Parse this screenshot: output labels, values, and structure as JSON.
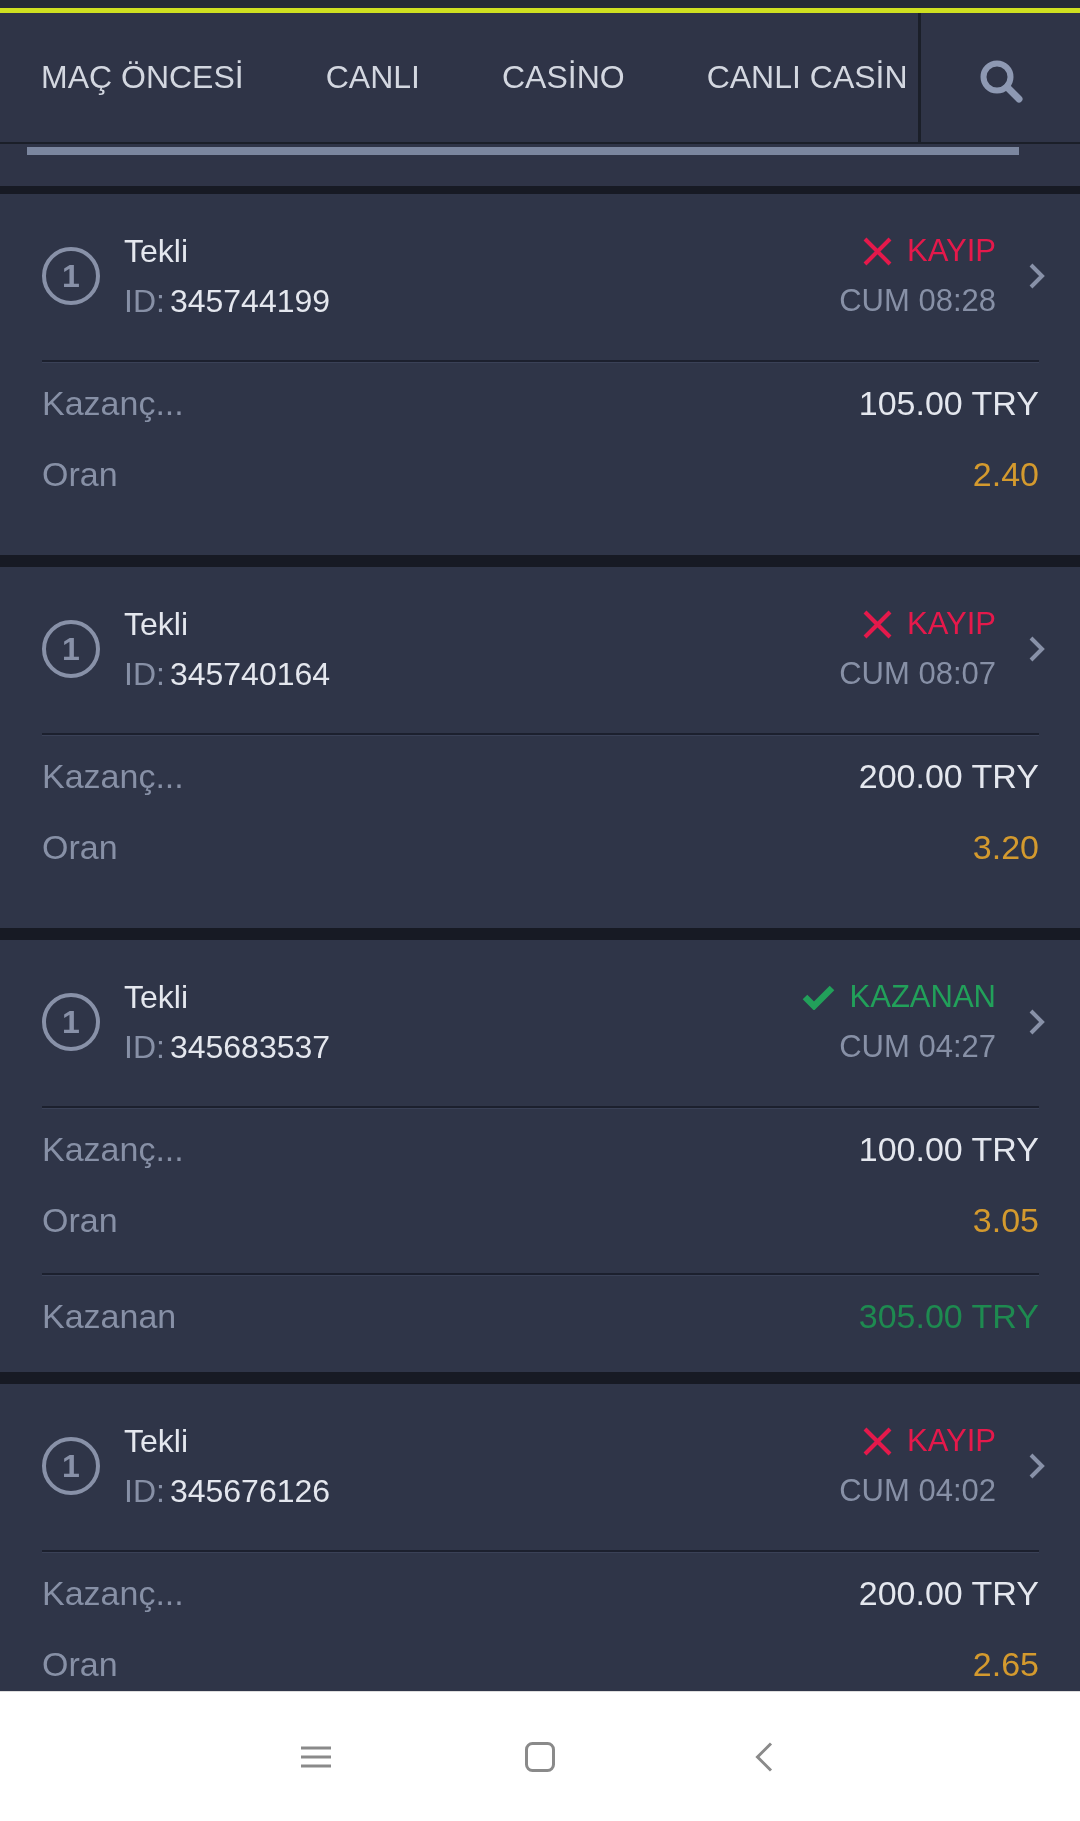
{
  "tabs": [
    {
      "label": "MAÇ ÖNCESİ"
    },
    {
      "label": "CANLI"
    },
    {
      "label": "CASİNO"
    },
    {
      "label": "CANLI CASİN"
    }
  ],
  "bets": [
    {
      "count": "1",
      "type": "Tekli",
      "id_label": "ID:",
      "id": "345744199",
      "won": false,
      "status_label": "KAYIP",
      "time": "CUM 08:28",
      "rows": [
        {
          "kind": "stake",
          "label": "Kazanç...",
          "value": "105.00 TRY"
        },
        {
          "kind": "odds",
          "label": "Oran",
          "value": "2.40"
        }
      ]
    },
    {
      "count": "1",
      "type": "Tekli",
      "id_label": "ID:",
      "id": "345740164",
      "won": false,
      "status_label": "KAYIP",
      "time": "CUM 08:07",
      "rows": [
        {
          "kind": "stake",
          "label": "Kazanç...",
          "value": "200.00 TRY"
        },
        {
          "kind": "odds",
          "label": "Oran",
          "value": "3.20"
        }
      ]
    },
    {
      "count": "1",
      "type": "Tekli",
      "id_label": "ID:",
      "id": "345683537",
      "won": true,
      "status_label": "KAZANAN",
      "time": "CUM 04:27",
      "rows": [
        {
          "kind": "stake",
          "label": "Kazanç...",
          "value": "100.00 TRY"
        },
        {
          "kind": "odds",
          "label": "Oran",
          "value": "3.05"
        },
        {
          "kind": "winnings",
          "label": "Kazanan",
          "value": "305.00 TRY"
        }
      ]
    },
    {
      "count": "1",
      "type": "Tekli",
      "id_label": "ID:",
      "id": "345676126",
      "won": false,
      "status_label": "KAYIP",
      "time": "CUM 04:02",
      "rows": [
        {
          "kind": "stake",
          "label": "Kazanç...",
          "value": "200.00 TRY"
        },
        {
          "kind": "odds",
          "label": "Oran",
          "value": "2.65"
        }
      ]
    }
  ]
}
